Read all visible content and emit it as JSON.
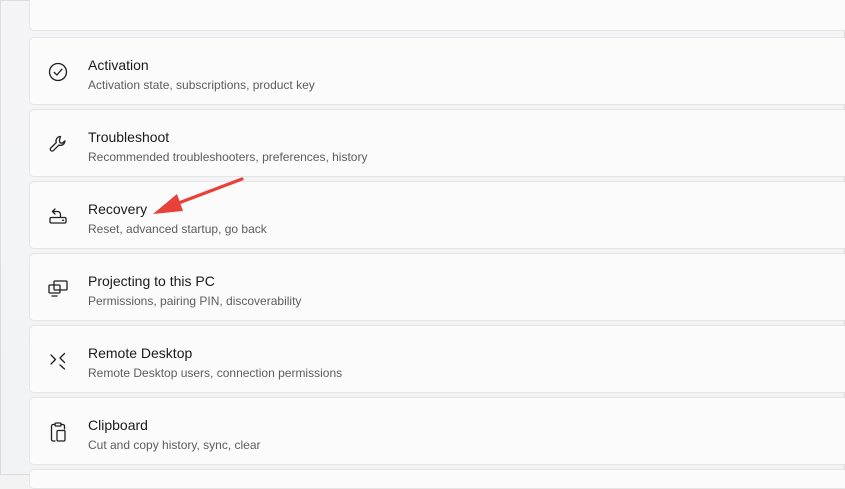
{
  "settings": {
    "items": [
      {
        "title": "Activation",
        "subtitle": "Activation state, subscriptions, product key",
        "icon": "check-circle-icon"
      },
      {
        "title": "Troubleshoot",
        "subtitle": "Recommended troubleshooters, preferences, history",
        "icon": "wrench-icon"
      },
      {
        "title": "Recovery",
        "subtitle": "Reset, advanced startup, go back",
        "icon": "recovery-icon"
      },
      {
        "title": "Projecting to this PC",
        "subtitle": "Permissions, pairing PIN, discoverability",
        "icon": "projecting-icon"
      },
      {
        "title": "Remote Desktop",
        "subtitle": "Remote Desktop users, connection permissions",
        "icon": "remote-desktop-icon"
      },
      {
        "title": "Clipboard",
        "subtitle": "Cut and copy history, sync, clear",
        "icon": "clipboard-icon"
      }
    ]
  },
  "colors": {
    "annotation_arrow": "#e8413a",
    "card_background": "#fbfbfb",
    "page_background": "#f3f3f3"
  }
}
